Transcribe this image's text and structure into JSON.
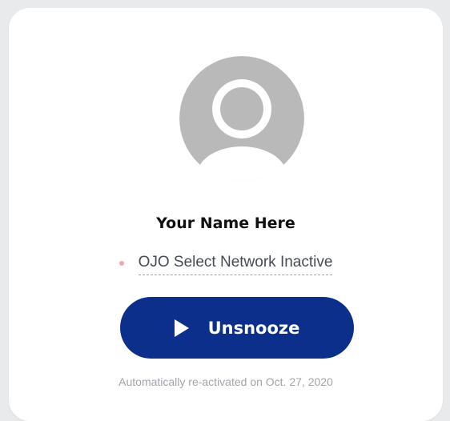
{
  "profile": {
    "name": "Your Name Here",
    "avatar_icon": "default-user-avatar-icon"
  },
  "status": {
    "label": "OJO Select Network Inactive",
    "dot_color": "#f4a7a7"
  },
  "action": {
    "label": "Unsnooze",
    "icon": "play-icon",
    "color": "#0b2f8a"
  },
  "footnote": {
    "text": "Automatically re-activated on Oct. 27, 2020"
  }
}
